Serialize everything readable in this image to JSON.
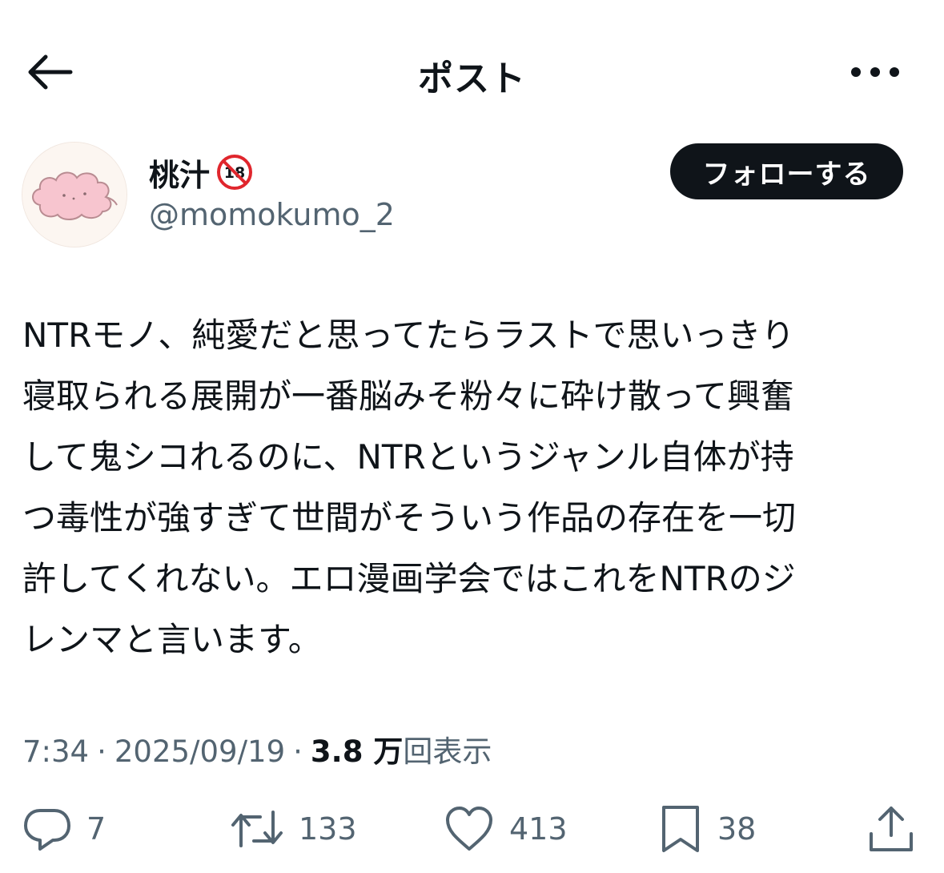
{
  "header": {
    "title": "ポスト",
    "back_icon": "arrow-left-icon",
    "more_icon": "more-horizontal-icon"
  },
  "author": {
    "name": "桃汁",
    "badge_icon": "no-under-18-icon",
    "handle": "@momokumo_2",
    "avatar_icon": "pink-cloud-avatar"
  },
  "follow_button": {
    "label": "フォローする"
  },
  "post": {
    "text": "NTRモノ、純愛だと思ってたらラストで思いっきり\n寝取られる展開が一番脳みそ粉々に砕け散って興奮\nして鬼シコれるのに、NTRというジャンル自体が持\nつ毒性が強すぎて世間がそういう作品の存在を一切\n許してくれない。エロ漫画学会ではこれをNTRのジ\nレンマと言います。"
  },
  "meta": {
    "time": "7:34",
    "separator": "·",
    "date": "2025/09/19",
    "views_count": "3.8 万",
    "views_label": "回表示"
  },
  "actions": {
    "reply": {
      "icon": "reply-icon",
      "count": "7"
    },
    "repost": {
      "icon": "repost-icon",
      "count": "133"
    },
    "like": {
      "icon": "heart-icon",
      "count": "413"
    },
    "bookmark": {
      "icon": "bookmark-icon",
      "count": "38"
    },
    "share": {
      "icon": "share-icon"
    }
  },
  "colors": {
    "text_primary": "#0f1419",
    "text_secondary": "#536471",
    "button_bg": "#0f1419",
    "badge_red": "#e0262d",
    "avatar_cloud": "#f7c5cf"
  }
}
